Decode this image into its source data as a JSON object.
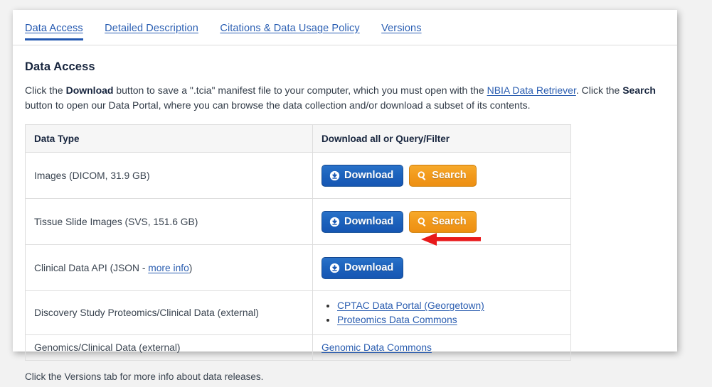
{
  "tabs": [
    {
      "label": "Data Access",
      "active": true
    },
    {
      "label": "Detailed Description",
      "active": false
    },
    {
      "label": "Citations & Data Usage Policy",
      "active": false
    },
    {
      "label": "Versions",
      "active": false
    }
  ],
  "page_title": "Data Access",
  "intro": {
    "p1_a": "Click the ",
    "p1_b": "Download",
    "p1_c": " button to save a \".tcia\" manifest file to your computer, which you must open with the ",
    "p1_link": "NBIA Data Retriever",
    "p1_d": ". Click the ",
    "p1_e": "Search",
    "p1_f": " button to open our Data Portal, where you can browse the data collection and/or download a subset of its contents."
  },
  "table": {
    "headers": [
      "Data Type",
      "Download all or Query/Filter"
    ],
    "rows": [
      {
        "type_text": "Images (DICOM, 31.9 GB)",
        "buttons": [
          "Download",
          "Search"
        ]
      },
      {
        "type_text": "Tissue Slide Images (SVS, 151.6 GB)",
        "buttons": [
          "Download",
          "Search"
        ]
      },
      {
        "type_prefix": "Clinical Data API (JSON - ",
        "type_link": "more info",
        "type_suffix": ")",
        "buttons": [
          "Download"
        ]
      },
      {
        "type_text": "Discovery Study Proteomics/Clinical Data (external)",
        "links": [
          "CPTAC Data Portal (Georgetown)",
          "Proteomics Data Commons"
        ]
      },
      {
        "type_text": "Genomics/Clinical Data (external)",
        "single_link": "Genomic Data Commons"
      }
    ]
  },
  "footnote": "Click the Versions tab for more info about data releases.",
  "icons": {
    "download": "download-circle-arrow-icon",
    "search": "magnifier-icon",
    "annotation": "red-left-arrow-annotation"
  },
  "colors": {
    "download_button": "#1d63bd",
    "search_button": "#f29a1c",
    "link": "#2a5db0",
    "active_tab": "#2257b0",
    "annotation_arrow": "#e8191b"
  }
}
